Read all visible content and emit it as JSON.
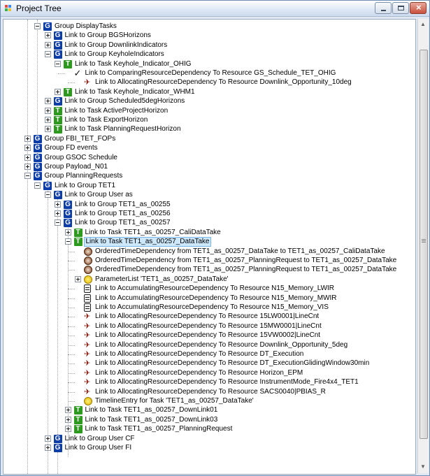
{
  "window": {
    "title": "Project Tree"
  },
  "tree": {
    "rows": [
      {
        "level": 0,
        "exp": "minus",
        "icon": "group",
        "label": "Group DisplayTasks"
      },
      {
        "level": 1,
        "exp": "plus",
        "icon": "group",
        "label": "Link to Group BGSHorizons"
      },
      {
        "level": 1,
        "exp": "plus",
        "icon": "group",
        "label": "Link to Group DownlinkIndicators"
      },
      {
        "level": 1,
        "exp": "minus",
        "icon": "group",
        "label": "Link to Group KeyholeIndicators"
      },
      {
        "level": 2,
        "exp": "minus",
        "icon": "task",
        "label": "Link to Task Keyhole_Indicator_OHIG"
      },
      {
        "level": 3,
        "exp": "none",
        "icon": "check",
        "label": "Link to ComparingResourceDependency To Resource GS_Schedule_TET_OHIG"
      },
      {
        "level": 4,
        "exp": "none",
        "icon": "allocating",
        "label": "Link to AllocatingResourceDependency To Resource Downlink_Opportunity_10deg"
      },
      {
        "level": 2,
        "exp": "plus",
        "icon": "task",
        "label": "Link to Task Keyhole_Indicator_WHM1"
      },
      {
        "level": 1,
        "exp": "plus",
        "icon": "group",
        "label": "Link to Group Scheduled5degHorizons"
      },
      {
        "level": 1,
        "exp": "plus",
        "icon": "task",
        "label": "Link to Task ActiveProjectHorizon"
      },
      {
        "level": 1,
        "exp": "plus",
        "icon": "task",
        "label": "Link to Task ExportHorizon"
      },
      {
        "level": 1,
        "exp": "plus",
        "icon": "task",
        "label": "Link to Task PlanningRequestHorizon"
      },
      {
        "level": -1,
        "exp": "plus",
        "icon": "group",
        "label": "Group FBI_TET_FOPs"
      },
      {
        "level": -1,
        "exp": "plus",
        "icon": "group",
        "label": "Group FD events"
      },
      {
        "level": -1,
        "exp": "plus",
        "icon": "group",
        "label": "Group GSOC Schedule"
      },
      {
        "level": -1,
        "exp": "plus",
        "icon": "group",
        "label": "Group Payload_N01"
      },
      {
        "level": -1,
        "exp": "minus",
        "icon": "group",
        "label": "Group PlanningRequests"
      },
      {
        "level": 0,
        "exp": "minus",
        "icon": "group",
        "label": "Link to Group TET1"
      },
      {
        "level": 1,
        "exp": "minus",
        "icon": "group",
        "label": "Link to Group User as"
      },
      {
        "level": 2,
        "exp": "plus",
        "icon": "group",
        "label": "Link to Group TET1_as_00255"
      },
      {
        "level": 2,
        "exp": "plus",
        "icon": "group",
        "label": "Link to Group TET1_as_00256"
      },
      {
        "level": 2,
        "exp": "minus",
        "icon": "group",
        "label": "Link to Group TET1_as_00257"
      },
      {
        "level": 3,
        "exp": "plus",
        "icon": "task",
        "label": "Link to Task TET1_as_00257_CaliDataTake"
      },
      {
        "level": 3,
        "exp": "minus",
        "icon": "task",
        "label": "Link to Task TET1_as_00257_DataTake",
        "selected": true
      },
      {
        "level": 4,
        "exp": "none",
        "icon": "ordered",
        "label": "OrderedTimeDependency from TET1_as_00257_DataTake to TET1_as_00257_CaliDataTake"
      },
      {
        "level": 4,
        "exp": "none",
        "icon": "ordered",
        "label": "OrderedTimeDependency from TET1_as_00257_PlanningRequest to TET1_as_00257_DataTake"
      },
      {
        "level": 4,
        "exp": "none",
        "icon": "ordered",
        "label": "OrderedTimeDependency from TET1_as_00257_PlanningRequest to TET1_as_00257_DataTake"
      },
      {
        "level": 4,
        "exp": "plus",
        "icon": "param",
        "label": "ParameterList 'TET1_as_00257_DataTake'"
      },
      {
        "level": 4,
        "exp": "none",
        "icon": "accumulating",
        "label": "Link to AccumulatingResourceDependency To Resource N15_Memory_LWIR"
      },
      {
        "level": 4,
        "exp": "none",
        "icon": "accumulating",
        "label": "Link to AccumulatingResourceDependency To Resource N15_Memory_MWIR"
      },
      {
        "level": 4,
        "exp": "none",
        "icon": "accumulating",
        "label": "Link to AccumulatingResourceDependency To Resource N15_Memory_VIS"
      },
      {
        "level": 4,
        "exp": "none",
        "icon": "allocating",
        "label": "Link to AllocatingResourceDependency To Resource 15LW0001|LineCnt"
      },
      {
        "level": 4,
        "exp": "none",
        "icon": "allocating",
        "label": "Link to AllocatingResourceDependency To Resource 15MW0001|LineCnt"
      },
      {
        "level": 4,
        "exp": "none",
        "icon": "allocating",
        "label": "Link to AllocatingResourceDependency To Resource 15VW0002|LineCnt"
      },
      {
        "level": 4,
        "exp": "none",
        "icon": "allocating",
        "label": "Link to AllocatingResourceDependency To Resource Downlink_Opportunity_5deg"
      },
      {
        "level": 4,
        "exp": "none",
        "icon": "allocating",
        "label": "Link to AllocatingResourceDependency To Resource DT_Execution"
      },
      {
        "level": 4,
        "exp": "none",
        "icon": "allocating",
        "label": "Link to AllocatingResourceDependency To Resource DT_ExecutionGlidingWindow30min"
      },
      {
        "level": 4,
        "exp": "none",
        "icon": "allocating",
        "label": "Link to AllocatingResourceDependency To Resource Horizon_EPM"
      },
      {
        "level": 4,
        "exp": "none",
        "icon": "allocating",
        "label": "Link to AllocatingResourceDependency To Resource InstrumentMode_Fire4x4_TET1"
      },
      {
        "level": 4,
        "exp": "none",
        "icon": "allocating",
        "label": "Link to AllocatingResourceDependency To Resource SACS0040|PBIAS_R"
      },
      {
        "level": 4,
        "exp": "none",
        "icon": "timeline",
        "label": "TimelineEntry for Task 'TET1_as_00257_DataTake'"
      },
      {
        "level": 3,
        "exp": "plus",
        "icon": "task",
        "label": "Link to Task TET1_as_00257_DownLink01"
      },
      {
        "level": 3,
        "exp": "plus",
        "icon": "task",
        "label": "Link to Task TET1_as_00257_DownLink03"
      },
      {
        "level": 3,
        "exp": "plus",
        "icon": "task",
        "label": "Link to Task TET1_as_00257_PlanningRequest"
      },
      {
        "level": 1,
        "exp": "plus",
        "icon": "group",
        "label": "Link to Group User CF"
      },
      {
        "level": 1,
        "exp": "plus",
        "icon": "group",
        "label": "Link to Group User FI"
      }
    ]
  }
}
